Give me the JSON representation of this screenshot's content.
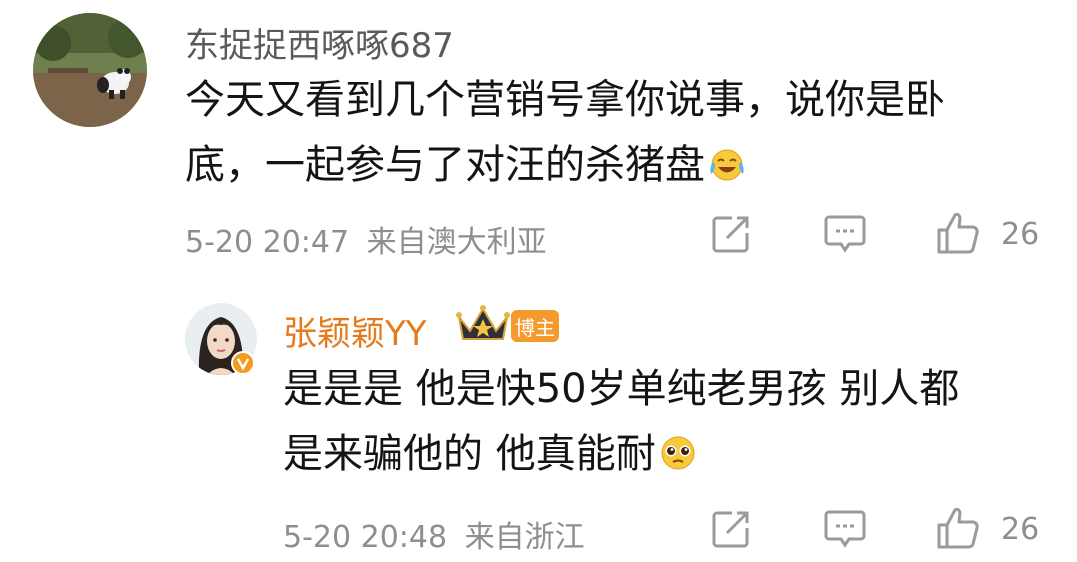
{
  "comment1": {
    "username": "东捉捉西啄啄687",
    "text_line1": "今天又看到几个营销号拿你说事，说你是卧",
    "text_line2": "底，一起参与了对汪的杀猪盘",
    "datetime": "5-20 20:47",
    "location": "来自澳大利亚",
    "like_count": "26"
  },
  "reply": {
    "username": "张颖颖YY",
    "badge": "博主",
    "text_line1": "是是是 他是快50岁单纯老男孩 别人都",
    "text_line2": "是来骗他的 他真能耐",
    "datetime": "5-20 20:48",
    "location": "来自浙江",
    "like_count": "26"
  },
  "colors": {
    "username1": "#5a5a5a",
    "username2": "#e57a1e",
    "badge_bg": "#f59a2d",
    "meta": "#8e8e8e"
  },
  "icons": {
    "share": "share-icon",
    "comment": "comment-icon",
    "like": "thumbs-up-icon",
    "verified": "verified-v-icon",
    "crown": "crown-icon",
    "laugh_cry": "laugh-cry-emoji",
    "pleading": "pleading-emoji"
  }
}
